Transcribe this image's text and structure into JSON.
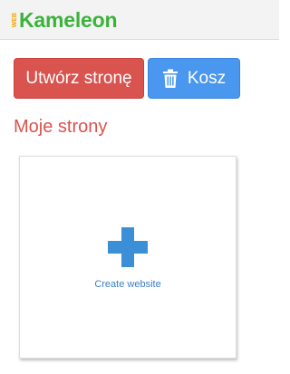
{
  "header": {
    "logo_prefix": "WEB",
    "logo_name": "Kameleon"
  },
  "toolbar": {
    "create_label": "Utwórz stronę",
    "trash_label": "Kosz"
  },
  "main": {
    "section_title": "Moje strony",
    "create_card_label": "Create website"
  },
  "colors": {
    "create_button": "#d9534f",
    "trash_button": "#4a97f0",
    "section_title": "#d9534f",
    "logo_green": "#3bb33b",
    "logo_web": "#f0a500",
    "plus_icon": "#3a8fd6"
  },
  "icons": {
    "trash": "trash-icon",
    "plus": "plus-icon"
  }
}
